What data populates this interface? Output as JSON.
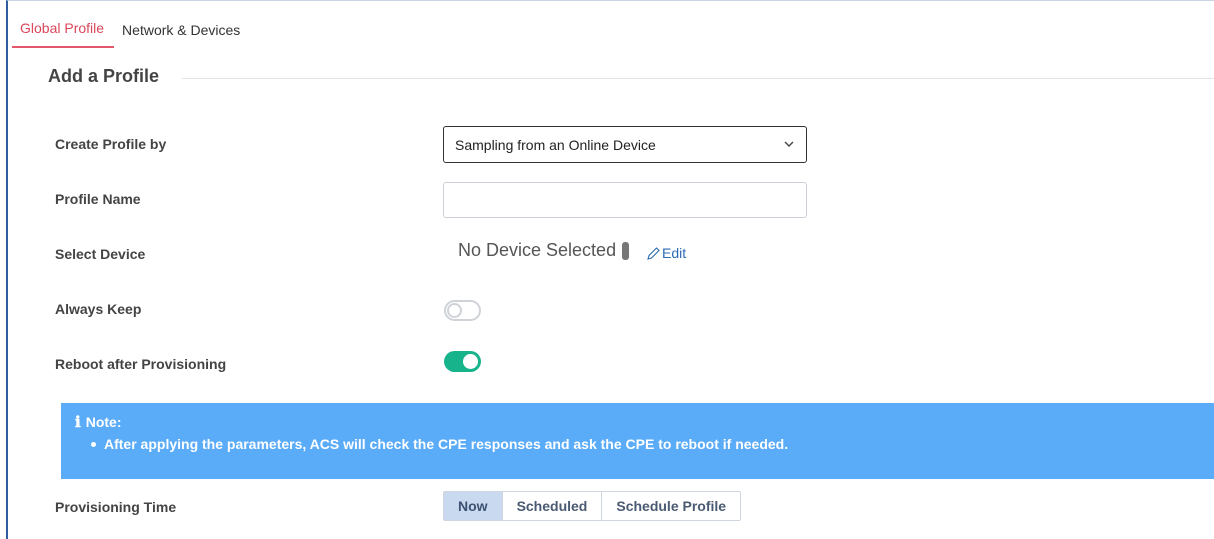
{
  "tabs": [
    {
      "label": "Global Profile",
      "active": true
    },
    {
      "label": "Network & Devices",
      "active": false
    }
  ],
  "section": {
    "title": "Add a Profile"
  },
  "form": {
    "create_by": {
      "label": "Create Profile by",
      "value": "Sampling from an Online Device"
    },
    "profile_name": {
      "label": "Profile Name",
      "value": ""
    },
    "select_device": {
      "label": "Select Device",
      "value": "No Device Selected",
      "edit_label": "Edit"
    },
    "always_keep": {
      "label": "Always Keep",
      "on": false
    },
    "reboot": {
      "label": "Reboot after Provisioning",
      "on": true
    },
    "provisioning_time": {
      "label": "Provisioning Time",
      "options": [
        "Now",
        "Scheduled",
        "Schedule Profile"
      ],
      "selected": "Now"
    }
  },
  "note": {
    "title": "Note:",
    "items": [
      "After applying the parameters, ACS will check the CPE responses and ask the CPE to reboot if needed."
    ]
  },
  "colors": {
    "tab_active": "#d9485b",
    "toggle_on": "#17b38a",
    "note_bg": "#5aabf8",
    "link": "#2c6bb5"
  },
  "icons": {
    "select_chevron": "chevron-down-icon",
    "edit": "pencil-icon",
    "note": "info-icon"
  }
}
